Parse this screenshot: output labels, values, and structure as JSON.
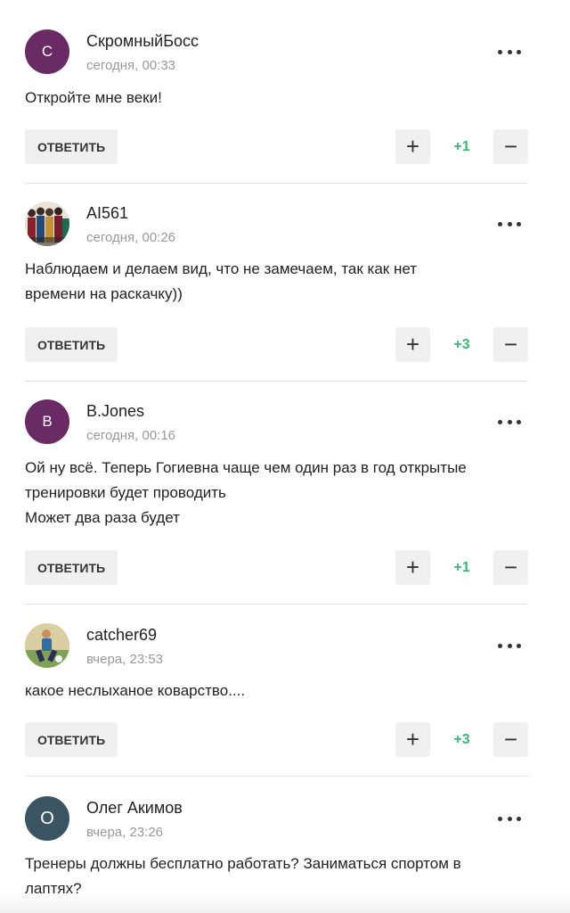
{
  "comments": [
    {
      "avatar_letter": "С",
      "avatar_color": "#6a2a63",
      "author": "СкромныйБосс",
      "date": "сегодня, 00:33",
      "text_lines": [
        "Откройте мне веки!"
      ],
      "reply_label": "ОТВЕТИТЬ",
      "score": "+1"
    },
    {
      "avatar_icon": "user-photo-icon",
      "author": "AI561",
      "date": "сегодня, 00:26",
      "text_lines": [
        "Наблюдаем и делаем вид, что не замечаем, так как нет",
        "времени на раскачку))"
      ],
      "reply_label": "ОТВЕТИТЬ",
      "score": "+3"
    },
    {
      "avatar_letter": "B",
      "avatar_color": "#6a2a63",
      "author": "B.Jones",
      "date": "сегодня, 00:16",
      "text_lines": [
        "Ой ну всё. Теперь Гогиевна чаще чем один раз в год открытые",
        "тренировки будет проводить",
        "Может два раза будет"
      ],
      "reply_label": "ОТВЕТИТЬ",
      "score": "+1"
    },
    {
      "avatar_icon": "user-photo-icon",
      "author": "catcher69",
      "date": "вчера, 23:53",
      "text_lines": [
        "какое неслыханое коварство...."
      ],
      "reply_label": "ОТВЕТИТЬ",
      "score": "+3"
    },
    {
      "avatar_letter": "О",
      "avatar_color": "#3c5562",
      "author": "Олег Акимов",
      "date": "вчера, 23:26",
      "text_lines": [
        "Тренеры должны бесплатно работать? Заниматься спортом в",
        "лаптях?"
      ]
    }
  ],
  "icons": {
    "more": "more-dots-icon",
    "plus": "+",
    "minus": "−"
  },
  "colors": {
    "score_positive": "#3bb877",
    "button_bg": "#f0f0f0",
    "date_text": "#999999"
  }
}
